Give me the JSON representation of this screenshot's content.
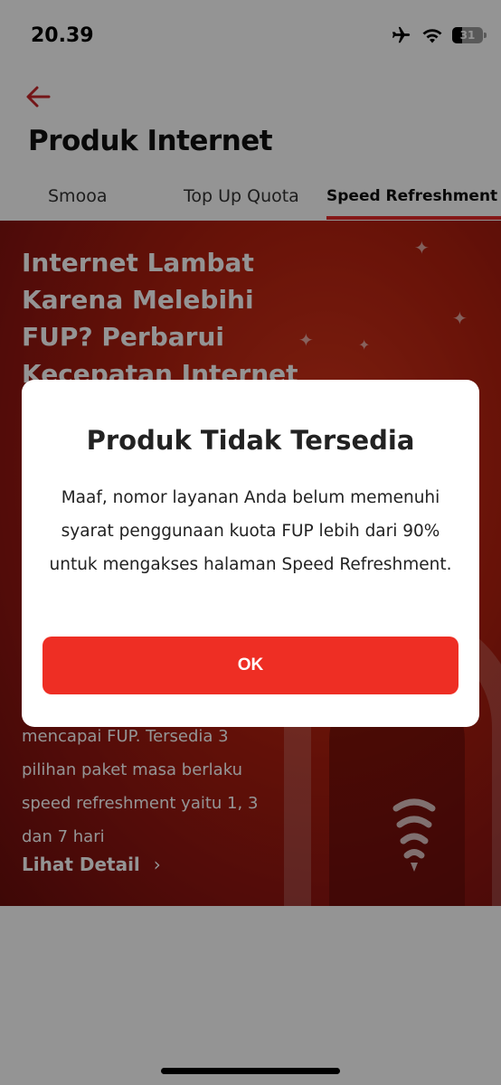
{
  "status_bar": {
    "time": "20.39",
    "battery_level": "31",
    "icons": [
      "airplane-icon",
      "wifi-icon",
      "battery-icon"
    ]
  },
  "header": {
    "title": "Produk Internet"
  },
  "tabs": [
    {
      "label": "Smooa",
      "active": false
    },
    {
      "label": "Top Up Quota",
      "active": false
    },
    {
      "label": "Speed Refreshment",
      "active": true
    }
  ],
  "banner": {
    "headline": "Internet Lambat Karena Melebihi FUP? Perbarui Kecepatan Internet",
    "body": "mencapai FUP. Tersedia 3 pilihan paket masa berlaku speed refreshment yaitu 1, 3 dan 7 hari",
    "detail_link": "Lihat Detail"
  },
  "modal": {
    "title": "Produk Tidak Tersedia",
    "message": "Maaf, nomor layanan Anda belum memenuhi syarat penggunaan kuota FUP lebih dari 90% untuk mengakses halaman Speed Refreshment.",
    "ok_label": "OK"
  },
  "colors": {
    "accent": "#ee2e24",
    "banner_red": "#b3200f",
    "tab_underline": "#e52a2a"
  }
}
